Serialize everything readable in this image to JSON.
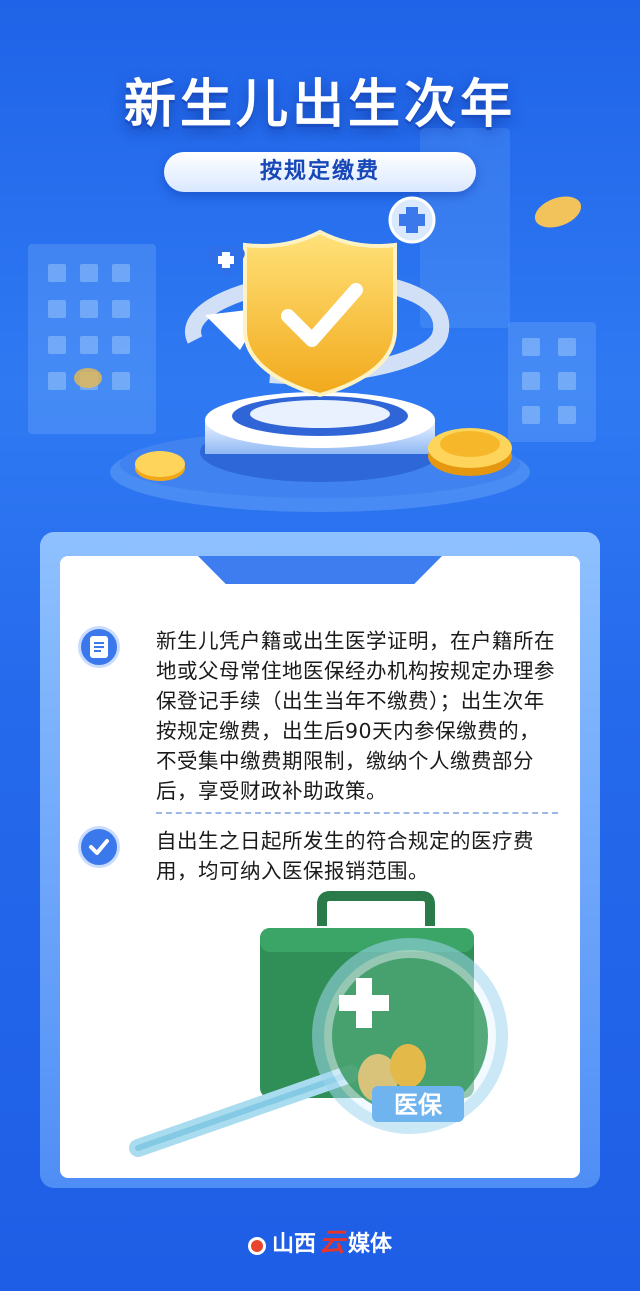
{
  "header": {
    "title": "新生儿出生次年",
    "subtitle": "按规定缴费"
  },
  "items": [
    {
      "icon": "document-icon",
      "text": "新生儿凭户籍或出生医学证明，在户籍所在地或父母常住地医保经办机构按规定办理参保登记手续（出生当年不缴费）；出生次年按规定缴费，出生后90天内参保缴费的，不受集中缴费期限制，缴纳个人缴费部分后，享受财政补助政策。"
    },
    {
      "icon": "check-icon",
      "text": "自出生之日起所发生的符合规定的医疗费用，均可纳入医保报销范围。"
    }
  ],
  "illustration": {
    "magnifier_label": "医保"
  },
  "footer": {
    "brand_left": "山西",
    "brand_cloud": "云",
    "brand_right": "媒体"
  },
  "colors": {
    "background": "#2569ec",
    "accent": "#3b78ec",
    "shield": "#f7c948",
    "kit": "#2f8f57"
  }
}
